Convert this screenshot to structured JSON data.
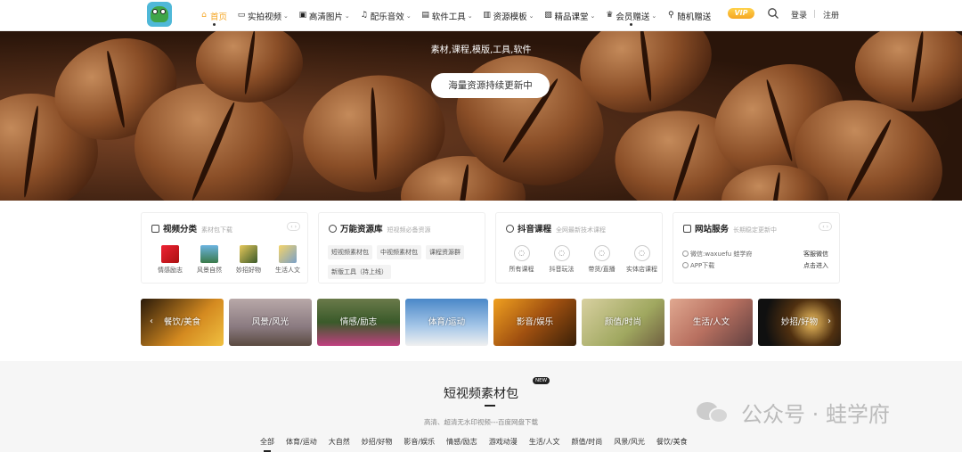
{
  "nav": {
    "items": [
      {
        "label": "首页",
        "icon": "home-icon",
        "active": true,
        "dropdown": false
      },
      {
        "label": "实拍视频",
        "icon": "video-icon",
        "dropdown": true
      },
      {
        "label": "高清图片",
        "icon": "image-icon",
        "dropdown": true
      },
      {
        "label": "配乐音效",
        "icon": "music-icon",
        "dropdown": true
      },
      {
        "label": "软件工具",
        "icon": "folder-icon",
        "dropdown": true
      },
      {
        "label": "资源模板",
        "icon": "template-icon",
        "dropdown": true
      },
      {
        "label": "精品课堂",
        "icon": "book-icon",
        "dropdown": true
      },
      {
        "label": "会员赠送",
        "icon": "crown-icon",
        "dropdown": true
      },
      {
        "label": "随机赠送",
        "icon": "location-icon",
        "dropdown": false
      }
    ],
    "vip": "VIP",
    "login": "登录",
    "register": "注册"
  },
  "hero": {
    "subtitle": "素材,课程,模版,工具,软件",
    "pill": "海量资源持续更新中"
  },
  "cards": {
    "video": {
      "title": "视频分类",
      "sub": "素材包下载",
      "items": [
        "情感励志",
        "风景自然",
        "妙招好物",
        "生活人文"
      ]
    },
    "resource": {
      "title": "万能资源库",
      "sub": "短视频必备资源",
      "tags": [
        "短视频素材包",
        "中视频素材包",
        "课程资源群",
        "新版工具（持上线）"
      ]
    },
    "douyin": {
      "title": "抖音课程",
      "sub": "全网最新技术课程",
      "items": [
        "所有课程",
        "抖音玩法",
        "带货/直播",
        "实体店课程"
      ]
    },
    "service": {
      "title": "网站服务",
      "sub": "长期稳定更新中",
      "rows": [
        {
          "left": "微信:waxuefu 蛙学府",
          "right": "客服微信"
        },
        {
          "left": "APP下载",
          "right": "点击进入"
        }
      ]
    }
  },
  "categories": [
    "餐饮/美食",
    "风景/风光",
    "情感/励志",
    "体育/运动",
    "影音/娱乐",
    "颜值/时尚",
    "生活/人文",
    "妙招/好物"
  ],
  "section": {
    "title": "短视频素材包",
    "badge": "NEW",
    "subtitle": "高清、超清无水印视频---百度网盘下载",
    "filters": [
      "全部",
      "体育/运动",
      "大自然",
      "妙招/好物",
      "影音/娱乐",
      "情感/励志",
      "游戏动漫",
      "生活/人文",
      "颜值/时尚",
      "风景/风光",
      "餐饮/美食"
    ]
  },
  "watermark": "公众号 · 蛙学府"
}
